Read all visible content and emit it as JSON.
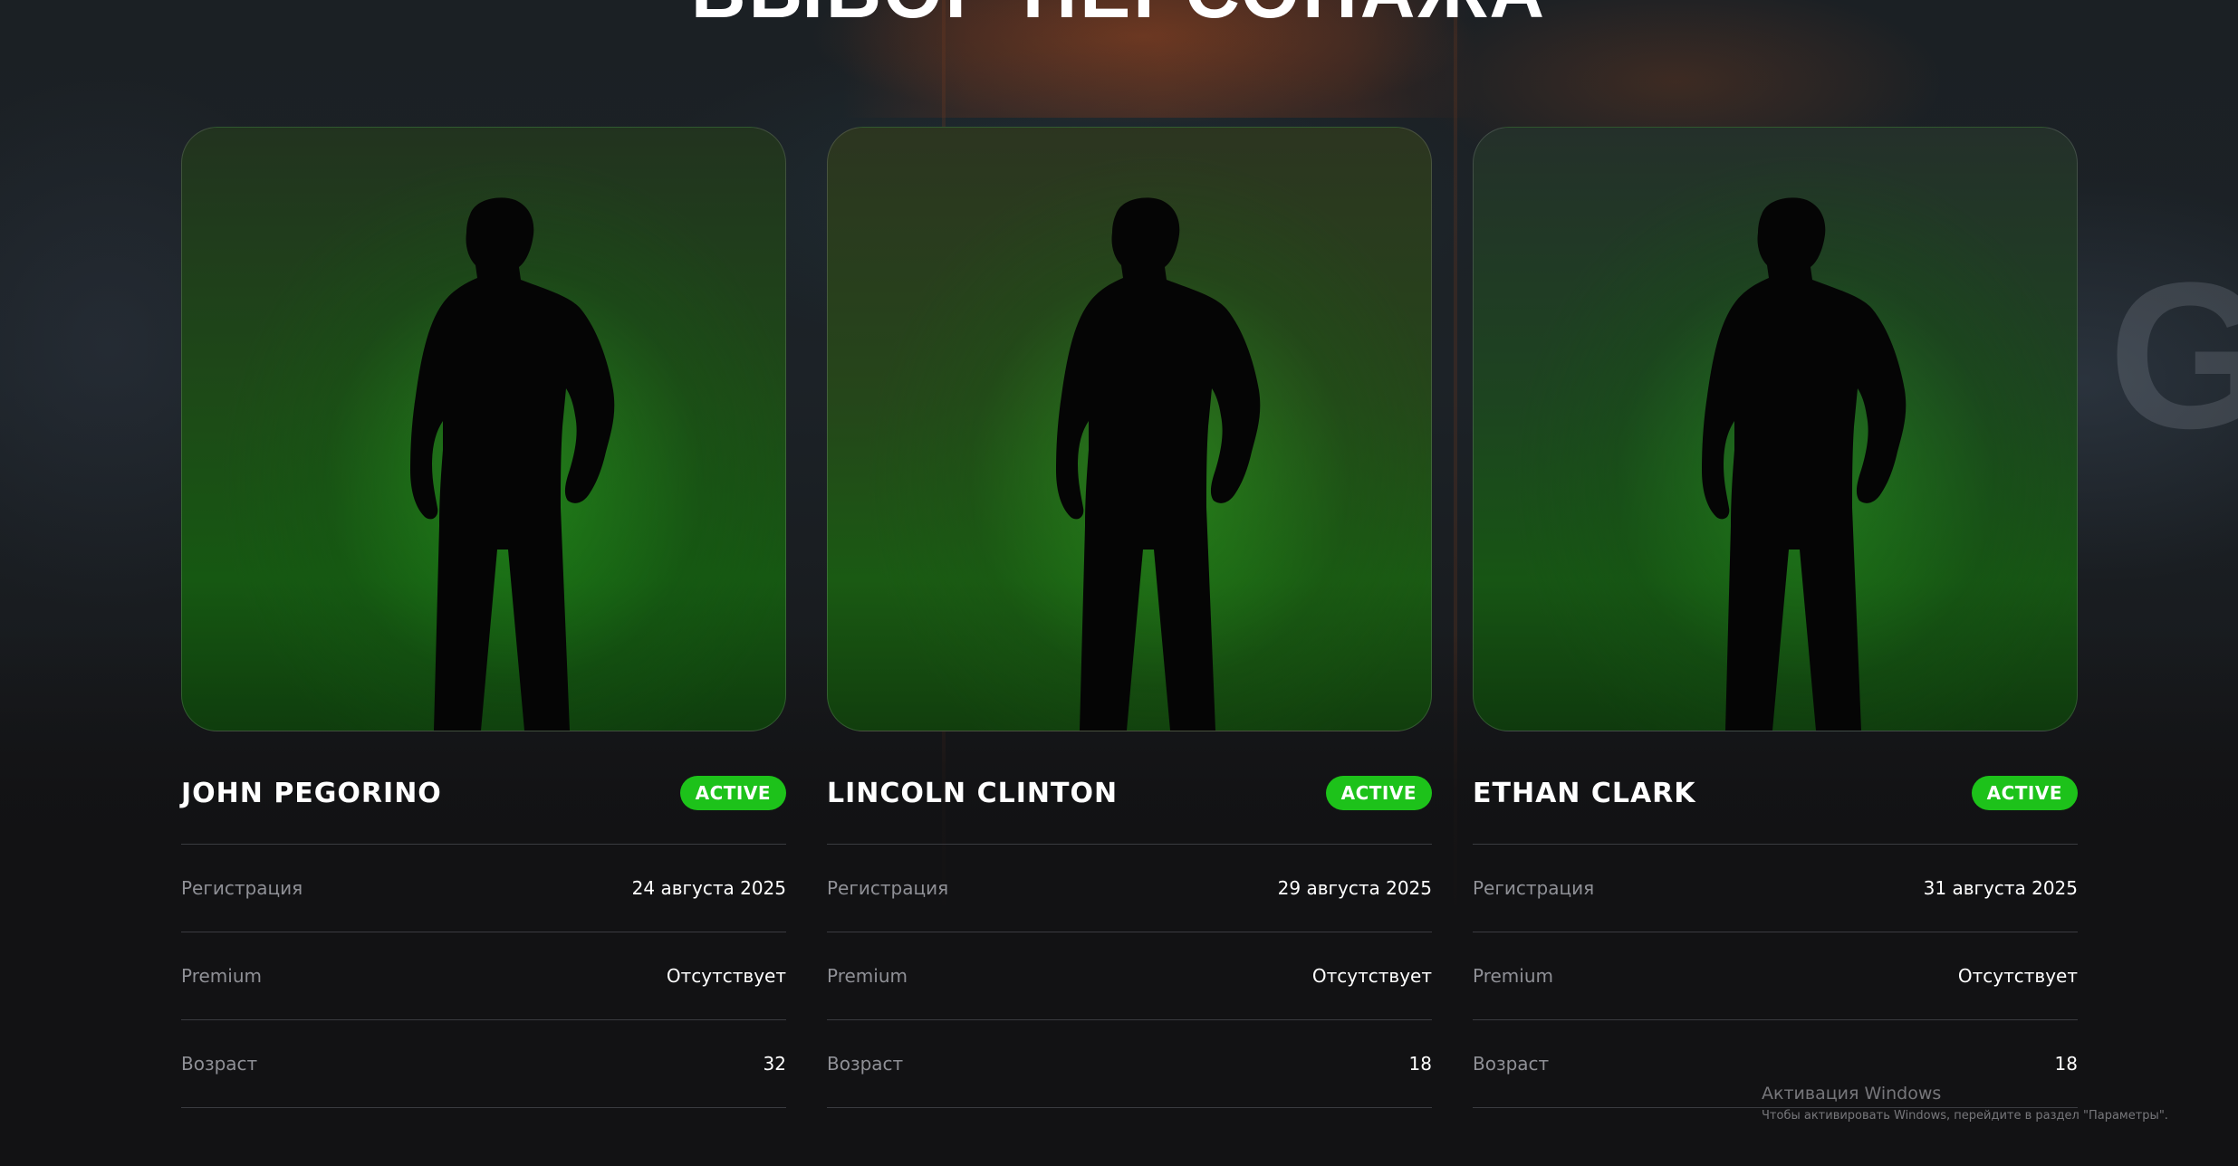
{
  "page": {
    "title": "ВЫБОР ПЕРСОНАЖА"
  },
  "colors": {
    "background": "#141416",
    "badge_active": "#1dc21a",
    "label_text": "#8f9096",
    "value_text": "#ffffff",
    "divider": "#3a3b40"
  },
  "characters": [
    {
      "name": "JOHN PEGORINO",
      "status": "ACTIVE",
      "rows": [
        {
          "label": "Регистрация",
          "value": "24 августа 2025"
        },
        {
          "label": "Premium",
          "value": "Отсутствует"
        },
        {
          "label": "Возраст",
          "value": "32"
        }
      ]
    },
    {
      "name": "LINCOLN CLINTON",
      "status": "ACTIVE",
      "rows": [
        {
          "label": "Регистрация",
          "value": "29 августа 2025"
        },
        {
          "label": "Premium",
          "value": "Отсутствует"
        },
        {
          "label": "Возраст",
          "value": "18"
        }
      ]
    },
    {
      "name": "ETHAN CLARK",
      "status": "ACTIVE",
      "rows": [
        {
          "label": "Регистрация",
          "value": "31 августа 2025"
        },
        {
          "label": "Premium",
          "value": "Отсутствует"
        },
        {
          "label": "Возраст",
          "value": "18"
        }
      ]
    }
  ],
  "os_watermark": {
    "title": "Активация Windows",
    "subtitle": "Чтобы активировать Windows, перейдите в раздел \"Параметры\"."
  }
}
